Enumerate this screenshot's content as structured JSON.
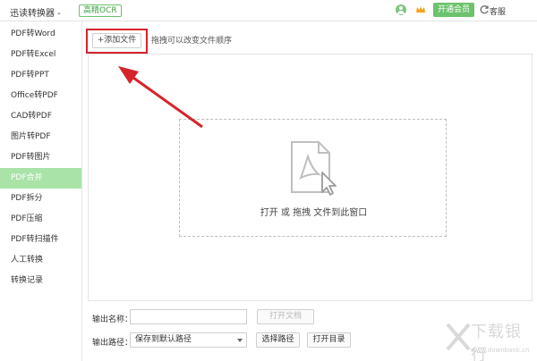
{
  "titlebar": {
    "app_title": "迅读转换器 -",
    "ocr_link": "高精OCR",
    "vip_button": "开通会员",
    "service_label": "客服",
    "icons": [
      "user-icon",
      "vip-crown-icon",
      "service-refresh-icon"
    ]
  },
  "sidebar": {
    "items": [
      {
        "label": "PDF转Word"
      },
      {
        "label": "PDF转Excel"
      },
      {
        "label": "PDF转PPT"
      },
      {
        "label": "Office转PDF"
      },
      {
        "label": "CAD转PDF"
      },
      {
        "label": "图片转PDF"
      },
      {
        "label": "PDF转图片"
      },
      {
        "label": "PDF合并"
      },
      {
        "label": "PDF拆分"
      },
      {
        "label": "PDF压缩"
      },
      {
        "label": "PDF转扫描件"
      },
      {
        "label": "人工转换"
      },
      {
        "label": "转换记录"
      }
    ],
    "active_index": 7
  },
  "main": {
    "add_file_button": "+添加文件",
    "hint": "拖拽可以改变文件顺序",
    "drop_text": "打开 或 拖拽 文件到此窗口",
    "doc_icon": "pdf-document-cursor-icon"
  },
  "bottom": {
    "output_name_label": "输出名称：",
    "output_name_value": "",
    "open_doc_button": "打开文档",
    "output_path_label": "输出路径：",
    "output_path_value": "保存到默认路径",
    "choose_path_button": "选择路径",
    "open_dir_button": "打开目录"
  },
  "watermark": {
    "text": "下载银行",
    "sub": "www.downbank.cn"
  },
  "colors": {
    "accent_green": "#6cc26d",
    "active_item": "#a9e3a8",
    "highlight_red": "#d5232b"
  }
}
